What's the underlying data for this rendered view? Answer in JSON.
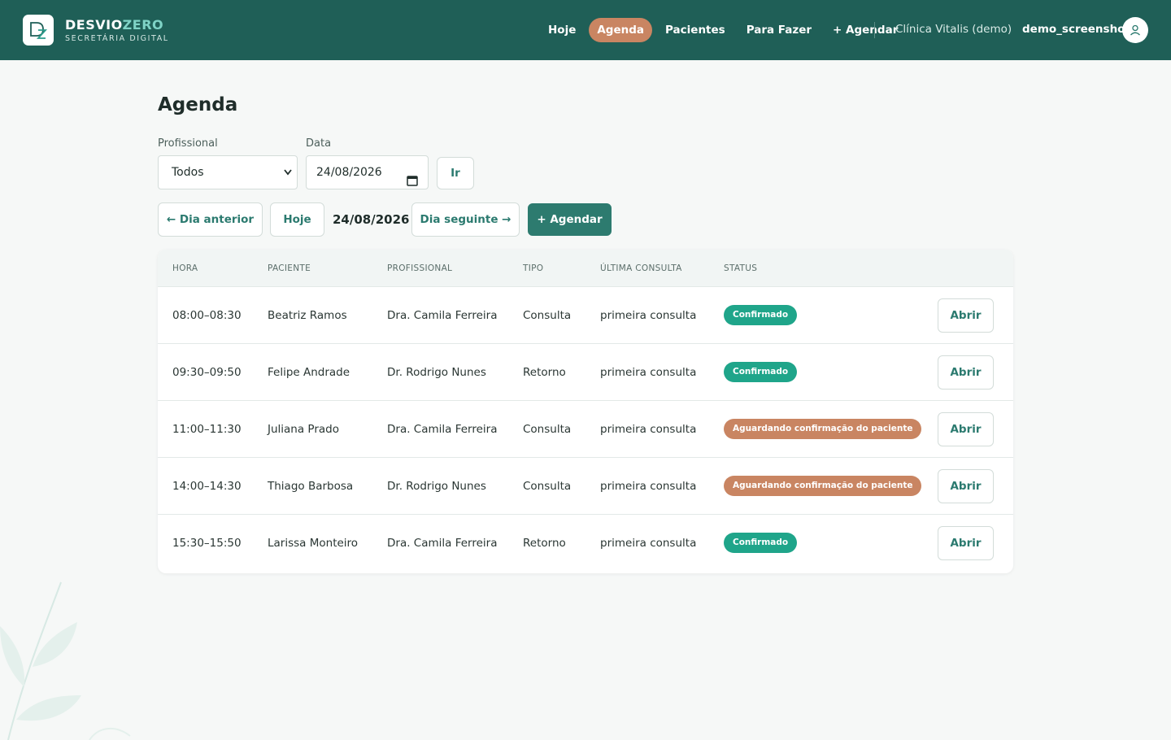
{
  "brand": {
    "name_main": "DESVIO",
    "name_accent": "ZERO",
    "subtitle": "SECRETÁRIA DIGITAL"
  },
  "nav": {
    "items": [
      {
        "label": "Hoje",
        "active": false
      },
      {
        "label": "Agenda",
        "active": true
      },
      {
        "label": "Pacientes",
        "active": false
      },
      {
        "label": "Para Fazer",
        "active": false
      },
      {
        "label": "+ Agendar",
        "active": false
      }
    ],
    "clinic": "Clínica Vitalis (demo)",
    "username": "demo_screenshot"
  },
  "page": {
    "title": "Agenda"
  },
  "filters": {
    "professional_label": "Profissional",
    "professional_value": "Todos",
    "date_label": "Data",
    "date_value": "24/08/2026",
    "go_label": "Ir"
  },
  "day_nav": {
    "prev_label": "← Dia anterior",
    "today_label": "Hoje",
    "current_date": "24/08/2026",
    "next_label": "Dia seguinte →",
    "schedule_label": "+ Agendar"
  },
  "table": {
    "headers": [
      "HORA",
      "PACIENTE",
      "PROFISSIONAL",
      "TIPO",
      "ÚLTIMA CONSULTA",
      "STATUS"
    ],
    "open_label": "Abrir",
    "rows": [
      {
        "hora": "08:00–08:30",
        "paciente": "Beatriz Ramos",
        "profissional": "Dra. Camila Ferreira",
        "tipo": "Consulta",
        "ultima": "primeira consulta",
        "status": "Confirmado",
        "status_kind": "ok"
      },
      {
        "hora": "09:30–09:50",
        "paciente": "Felipe Andrade",
        "profissional": "Dr. Rodrigo Nunes",
        "tipo": "Retorno",
        "ultima": "primeira consulta",
        "status": "Confirmado",
        "status_kind": "ok"
      },
      {
        "hora": "11:00–11:30",
        "paciente": "Juliana Prado",
        "profissional": "Dra. Camila Ferreira",
        "tipo": "Consulta",
        "ultima": "primeira consulta",
        "status": "Aguardando confirmação do paciente",
        "status_kind": "wait"
      },
      {
        "hora": "14:00–14:30",
        "paciente": "Thiago Barbosa",
        "profissional": "Dr. Rodrigo Nunes",
        "tipo": "Consulta",
        "ultima": "primeira consulta",
        "status": "Aguardando confirmação do paciente",
        "status_kind": "wait"
      },
      {
        "hora": "15:30–15:50",
        "paciente": "Larissa Monteiro",
        "profissional": "Dra. Camila Ferreira",
        "tipo": "Retorno",
        "ultima": "primeira consulta",
        "status": "Confirmado",
        "status_kind": "ok"
      }
    ]
  },
  "colors": {
    "header_bg": "#1f5f57",
    "accent_active": "#c98562",
    "primary_button": "#2d7b6f",
    "status_confirmed": "#1fa58a",
    "status_waiting": "#c98562"
  }
}
